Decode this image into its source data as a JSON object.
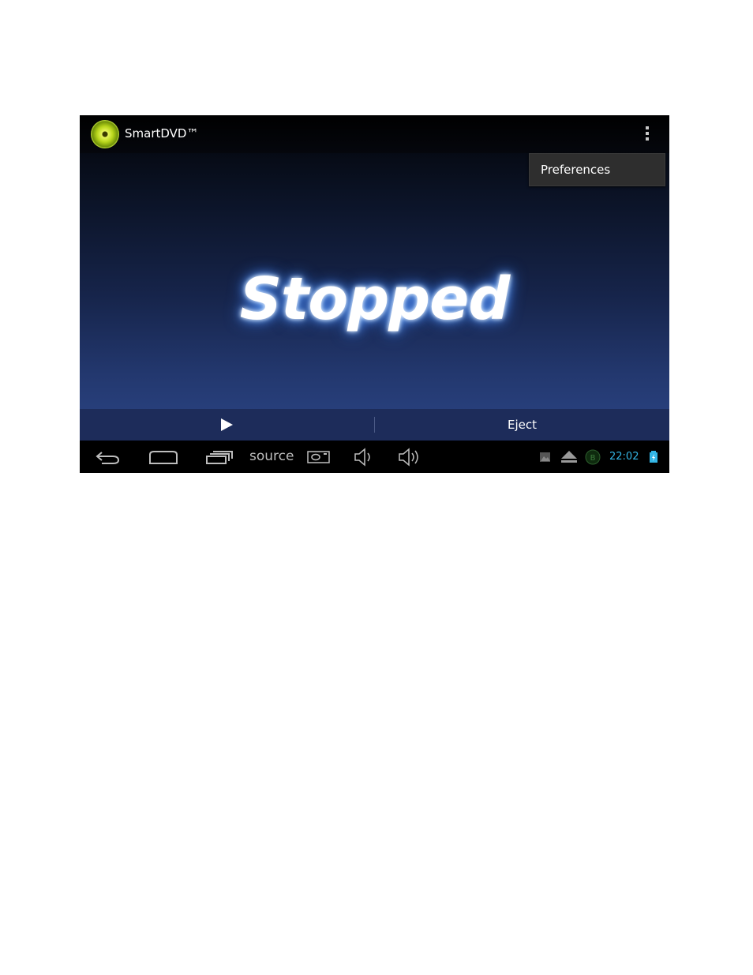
{
  "app": {
    "title": "SmartDVD™",
    "menu": {
      "items": [
        "Preferences"
      ]
    }
  },
  "player": {
    "status": "Stopped",
    "eject_label": "Eject"
  },
  "system_bar": {
    "source_label": "source",
    "clock": "22:02"
  },
  "colors": {
    "accent": "#33b5e5",
    "controls_bg": "#1d2c5a",
    "menu_bg": "#2e2e2e"
  },
  "icons": [
    "disc-logo-icon",
    "overflow-menu-icon",
    "play-icon",
    "back-icon",
    "home-icon",
    "recent-apps-icon",
    "screenshot-icon",
    "volume-down-icon",
    "volume-up-icon",
    "gallery-notification-icon",
    "eject-notification-icon",
    "android-notification-icon",
    "battery-icon"
  ]
}
